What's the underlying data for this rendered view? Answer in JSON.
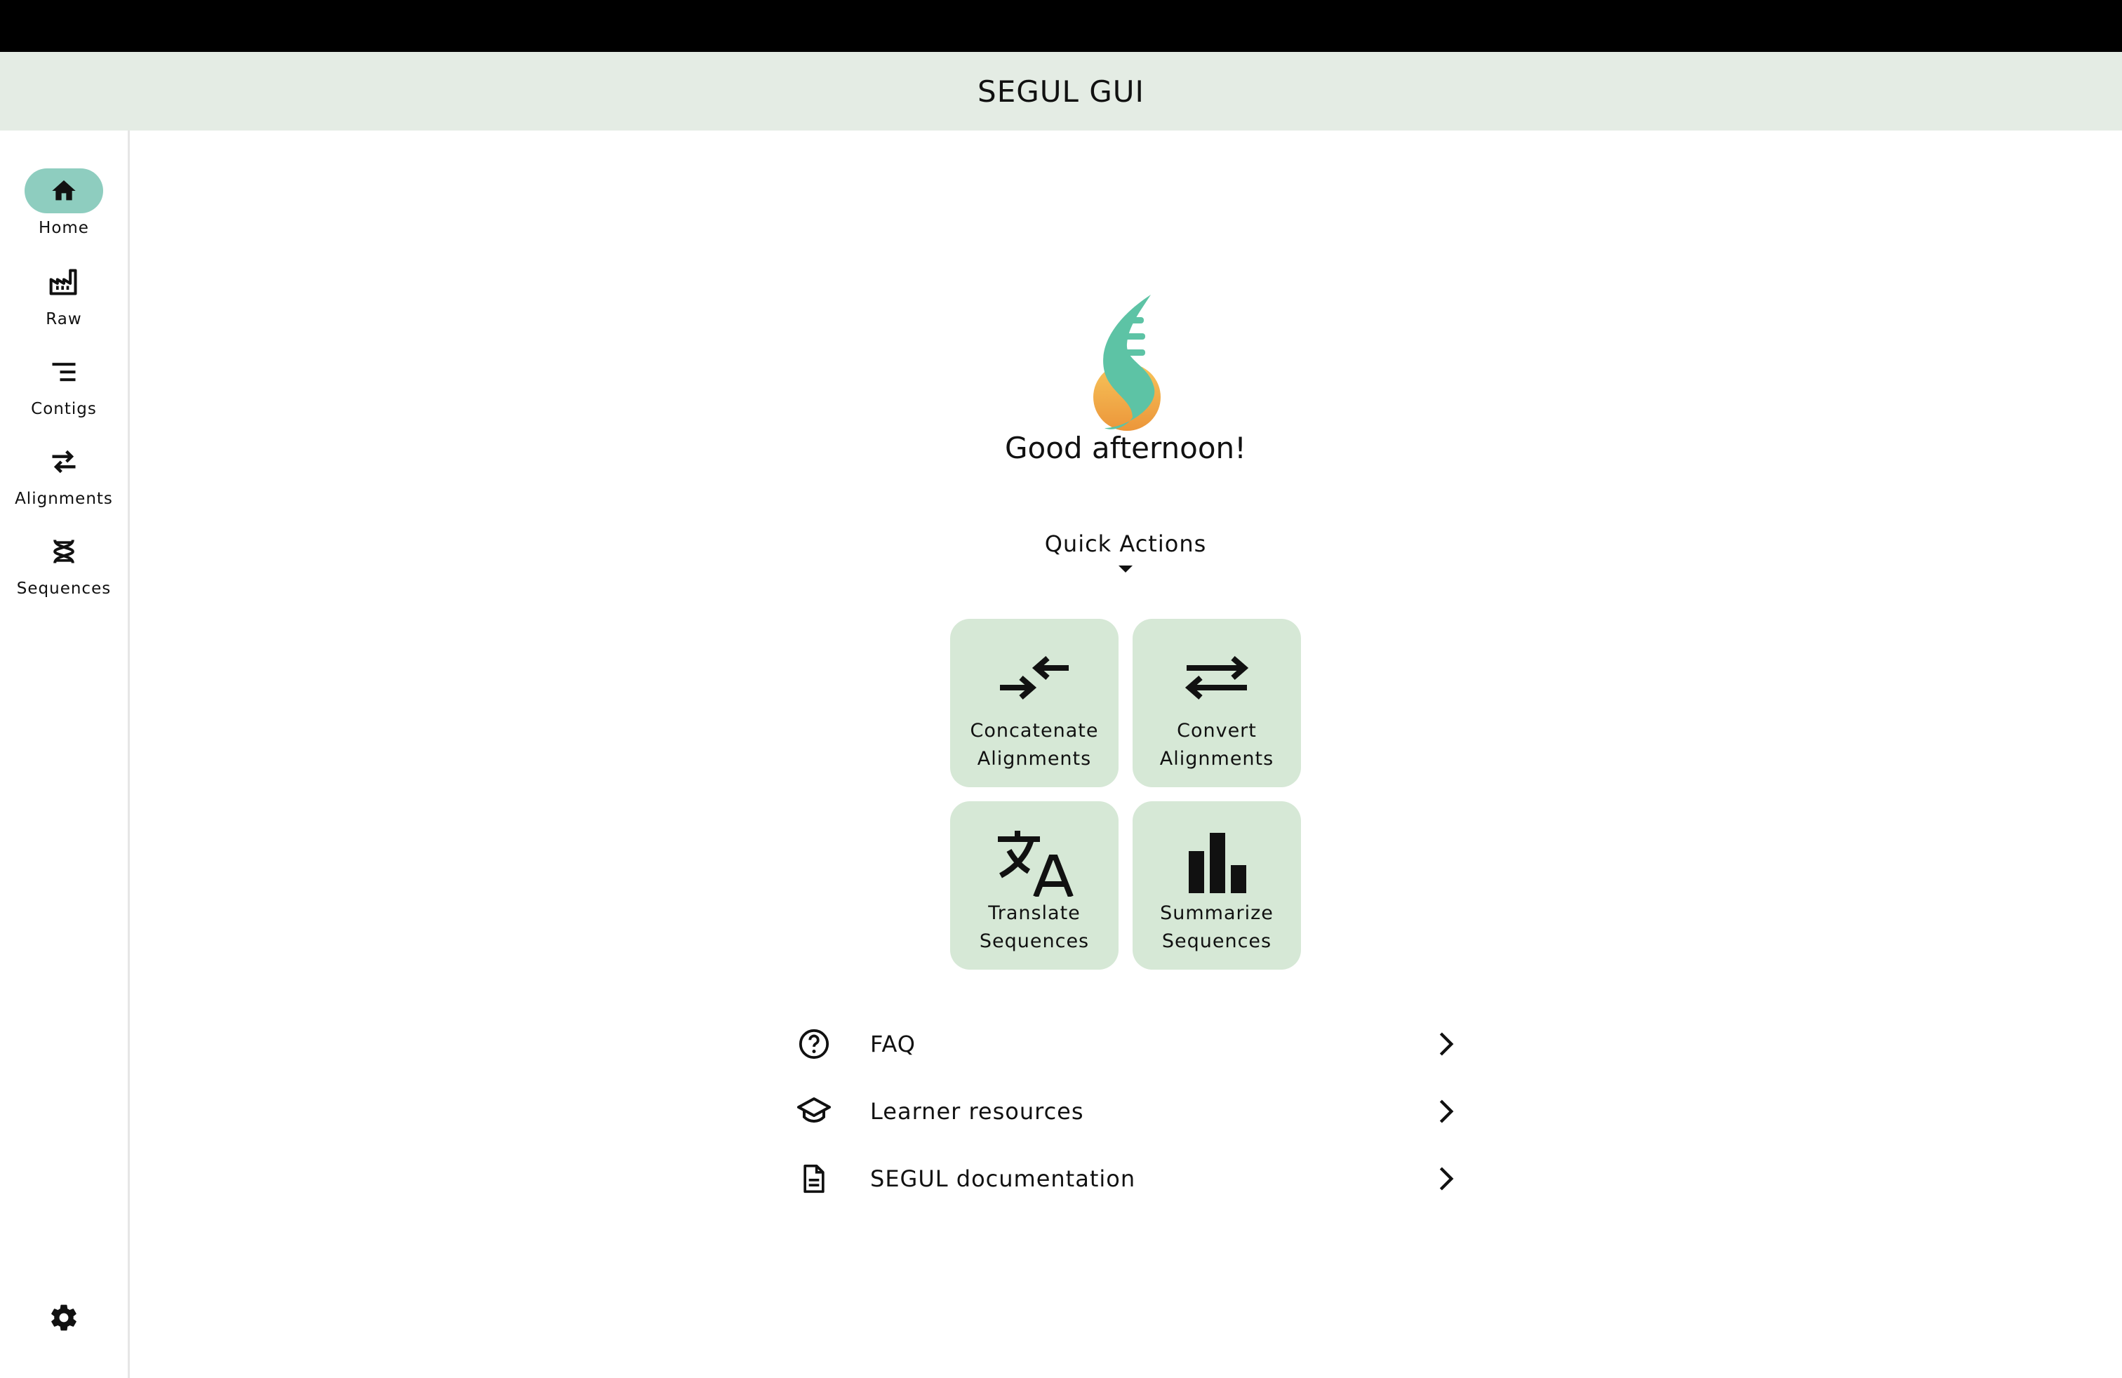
{
  "app": {
    "title": "SEGUL GUI"
  },
  "sidebar": {
    "items": [
      {
        "label": "Home",
        "icon": "home-icon",
        "active": true
      },
      {
        "label": "Raw",
        "icon": "factory-icon",
        "active": false
      },
      {
        "label": "Contigs",
        "icon": "lines-icon",
        "active": false
      },
      {
        "label": "Alignments",
        "icon": "swap-icon",
        "active": false
      },
      {
        "label": "Sequences",
        "icon": "dna-icon",
        "active": false
      }
    ],
    "settings_icon": "gear-icon"
  },
  "main": {
    "greeting": "Good afternoon!",
    "quick_actions": {
      "title": "Quick Actions",
      "cards": [
        {
          "label": "Concatenate\nAlignments",
          "icon": "concatenate-icon"
        },
        {
          "label": "Convert\nAlignments",
          "icon": "convert-icon"
        },
        {
          "label": "Translate\nSequences",
          "icon": "translate-icon"
        },
        {
          "label": "Summarize\nSequences",
          "icon": "bar-chart-icon"
        }
      ]
    },
    "links": [
      {
        "label": "FAQ",
        "icon": "help-circle-icon"
      },
      {
        "label": "Learner resources",
        "icon": "school-icon"
      },
      {
        "label": "SEGUL documentation",
        "icon": "document-icon"
      }
    ]
  },
  "colors": {
    "appbar_bg": "#e4ece4",
    "rail_active": "#8ecdbf",
    "card_bg": "#d6e8d6",
    "logo_teal": "#5dc3a5",
    "logo_orange": "#f0a33f"
  }
}
